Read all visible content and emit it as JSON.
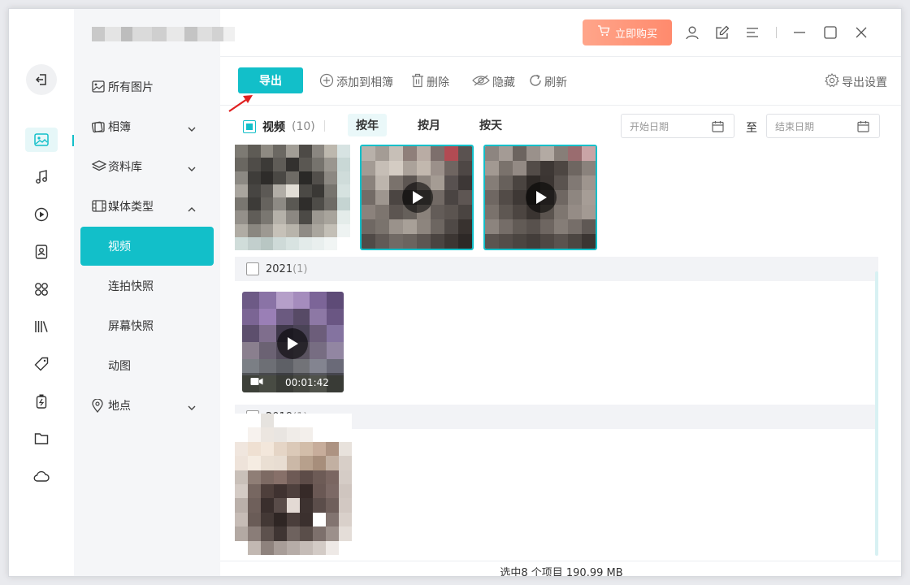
{
  "header": {
    "buy_label": "立即购买",
    "accent_color": "#12bfc9",
    "buy_color": "#ff8f72"
  },
  "rail": {
    "items": [
      "back-icon",
      "photo-icon",
      "music-icon",
      "play-circle-icon",
      "contacts-icon",
      "apps-icon",
      "library-icon",
      "tag-icon",
      "battery-icon",
      "folder-icon",
      "cloud-icon"
    ],
    "active": "photo-icon"
  },
  "sidebar": {
    "items": [
      {
        "label": "所有图片",
        "icon": "image-icon"
      },
      {
        "label": "相簿",
        "icon": "album-icon",
        "expand": "down"
      },
      {
        "label": "资料库",
        "icon": "layers-icon",
        "expand": "down"
      },
      {
        "label": "媒体类型",
        "icon": "film-icon",
        "expand": "up"
      },
      {
        "label": "视频",
        "selected": true
      },
      {
        "label": "连拍快照"
      },
      {
        "label": "屏幕快照"
      },
      {
        "label": "动图"
      },
      {
        "label": "地点",
        "icon": "location-icon",
        "expand": "down"
      }
    ]
  },
  "toolbar": {
    "export_label": "导出",
    "add_to_album_label": "添加到相簿",
    "delete_label": "删除",
    "hide_label": "隐藏",
    "refresh_label": "刷新",
    "export_settings_label": "导出设置"
  },
  "filter": {
    "title": "视频",
    "count": "(10)",
    "by_year": "按年",
    "by_month": "按月",
    "by_day": "按天",
    "start_date_placeholder": "开始日期",
    "to_label": "至",
    "end_date_placeholder": "结束日期"
  },
  "groups": [
    {
      "year": "2021",
      "count": "(1)",
      "duration": "00:01:42"
    },
    {
      "year": "2019",
      "count": "(1)"
    }
  ],
  "status": {
    "text": "选中8 个项目 190.99 MB"
  }
}
